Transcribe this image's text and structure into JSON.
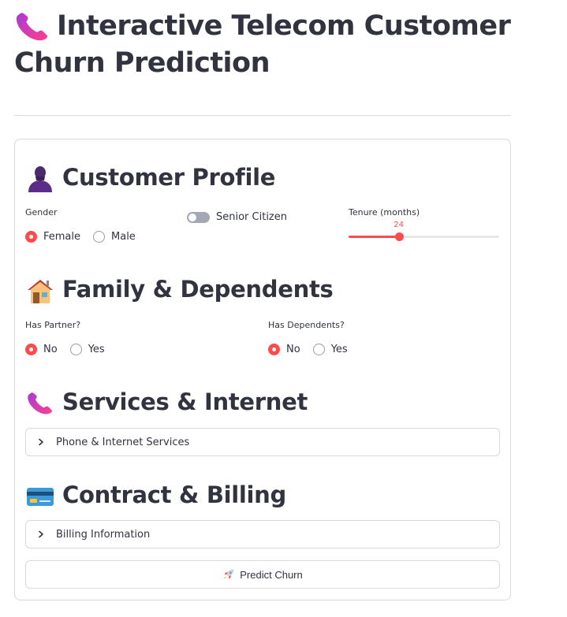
{
  "title": "Interactive Telecom Customer Churn Prediction",
  "icons": {
    "title": "telephone-receiver-icon",
    "profile": "person-silhouette-icon",
    "family": "house-icon",
    "services": "telephone-receiver-icon",
    "billing": "credit-card-icon",
    "predict": "rocket-icon",
    "expander": "chevron-right-icon"
  },
  "colors": {
    "accent": "#ff4b4b",
    "text": "#31333f",
    "border": "#d8d9dc"
  },
  "profile": {
    "heading": "Customer Profile",
    "gender": {
      "label": "Gender",
      "options": [
        "Female",
        "Male"
      ],
      "selected": "Female"
    },
    "senior": {
      "label": "Senior Citizen",
      "checked": false
    },
    "tenure": {
      "label": "Tenure (months)",
      "value": 24,
      "min": 0,
      "max": 72
    }
  },
  "family": {
    "heading": "Family & Dependents",
    "partner": {
      "label": "Has Partner?",
      "options": [
        "No",
        "Yes"
      ],
      "selected": "No"
    },
    "dependents": {
      "label": "Has Dependents?",
      "options": [
        "No",
        "Yes"
      ],
      "selected": "No"
    }
  },
  "services": {
    "heading": "Services & Internet",
    "expander": "Phone & Internet Services"
  },
  "billing": {
    "heading": "Contract & Billing",
    "expander": "Billing Information"
  },
  "predict": {
    "label": "Predict Churn"
  }
}
